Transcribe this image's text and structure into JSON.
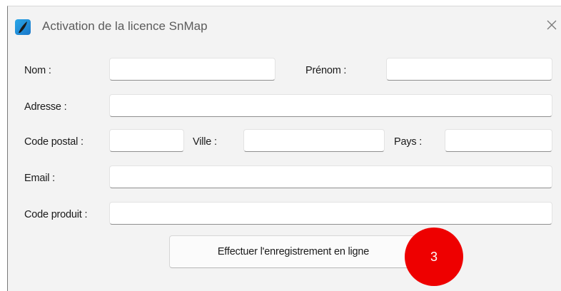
{
  "window": {
    "title": "Activation de la licence SnMap",
    "icon": "snmap-app-icon",
    "close_icon": "close-icon"
  },
  "form": {
    "nom_label": "Nom :",
    "nom_value": "",
    "prenom_label": "Prénom :",
    "prenom_value": "",
    "adresse_label": "Adresse :",
    "adresse_value": "",
    "code_postal_label": "Code postal :",
    "code_postal_value": "",
    "ville_label": "Ville :",
    "ville_value": "",
    "pays_label": "Pays :",
    "pays_value": "",
    "email_label": "Email :",
    "email_value": "",
    "code_produit_label": "Code produit :",
    "code_produit_value": ""
  },
  "submit_label": "Effectuer l'enregistrement en ligne",
  "annotation": {
    "step_number": "3",
    "color": "#ee0000"
  }
}
